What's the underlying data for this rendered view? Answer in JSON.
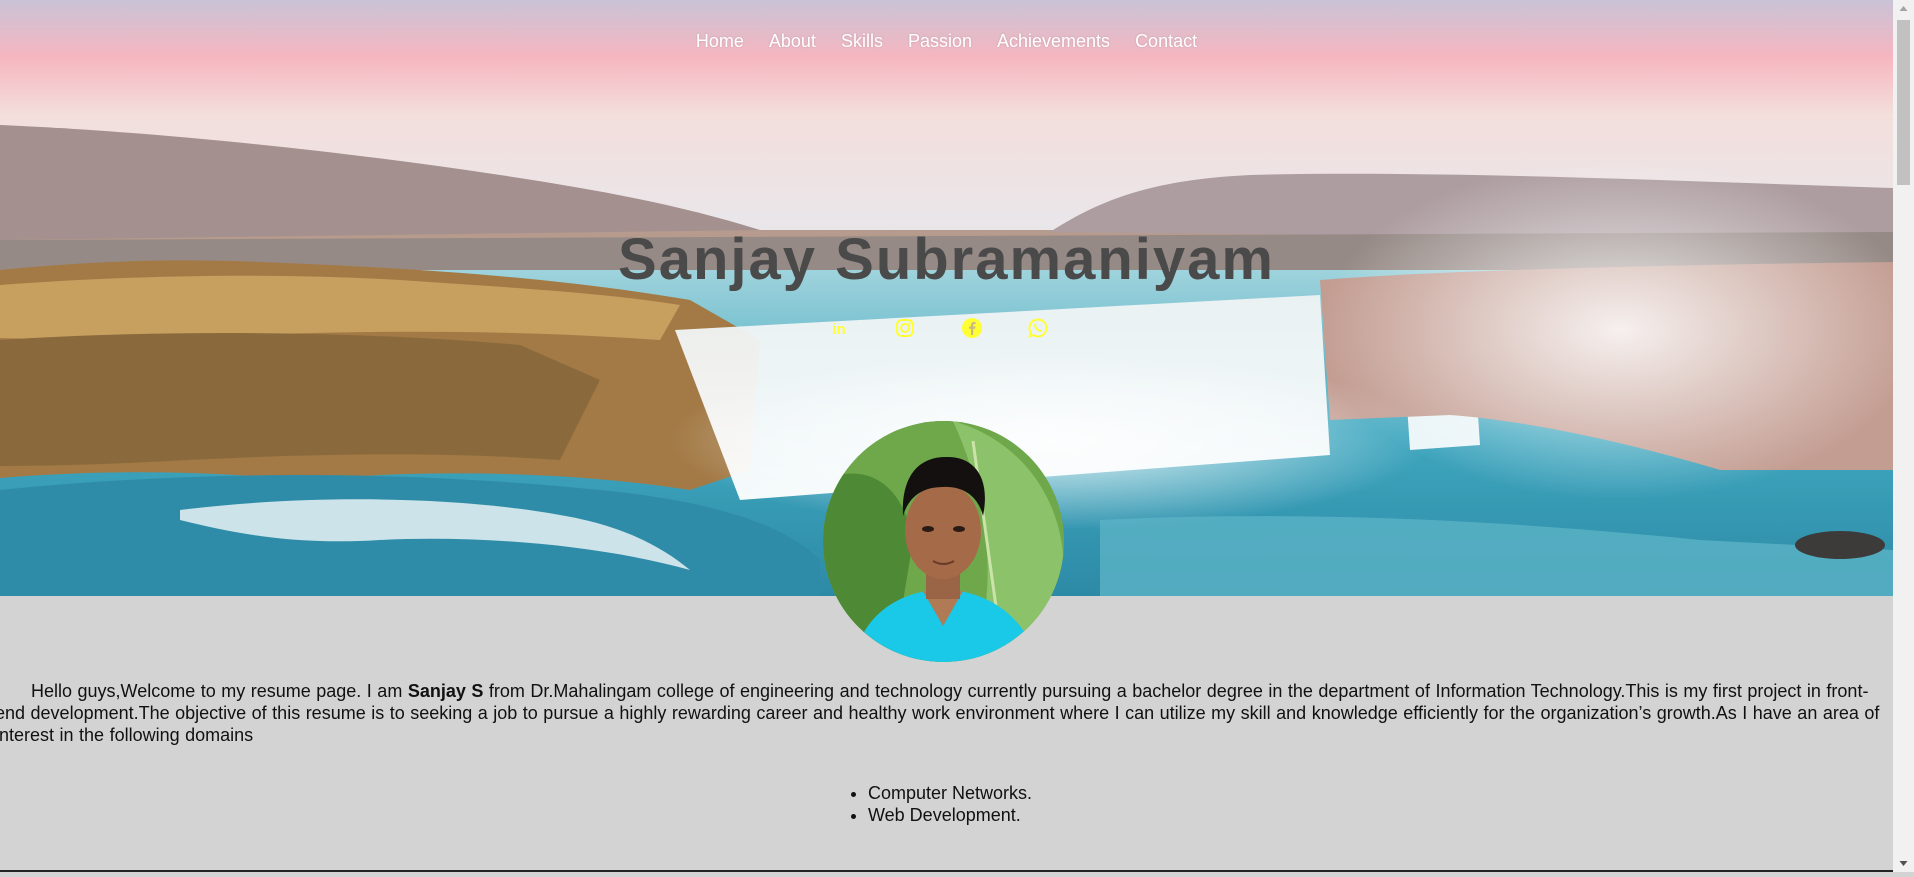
{
  "nav": {
    "items": [
      {
        "label": "Home"
      },
      {
        "label": "About"
      },
      {
        "label": "Skills"
      },
      {
        "label": "Passion"
      },
      {
        "label": "Achievements"
      },
      {
        "label": "Contact"
      }
    ]
  },
  "hero": {
    "name": "Sanjay Subramaniyam",
    "social_icons": [
      "linkedin-icon",
      "instagram-icon",
      "facebook-icon",
      "whatsapp-icon"
    ],
    "icon_color": "#ffff33"
  },
  "about": {
    "intro_prefix": "Hello guys,Welcome to my resume page. I am ",
    "intro_name": "Sanjay S",
    "intro_suffix": " from Dr.Mahalingam college of engineering and technology currently pursuing a bachelor degree in the department of Information Technology.This is my first project in front-end development.The objective of this resume is to seeking a job to pursue a highly rewarding career and healthy work environment where I can utilize my skill and knowledge efficiently for the organization’s growth.As I have an area of interest in the following domains",
    "domains": [
      "Computer Networks.",
      "Web Development."
    ]
  },
  "colors": {
    "page_background": "#d3d3d3",
    "title_color": "#4a4a4a"
  }
}
